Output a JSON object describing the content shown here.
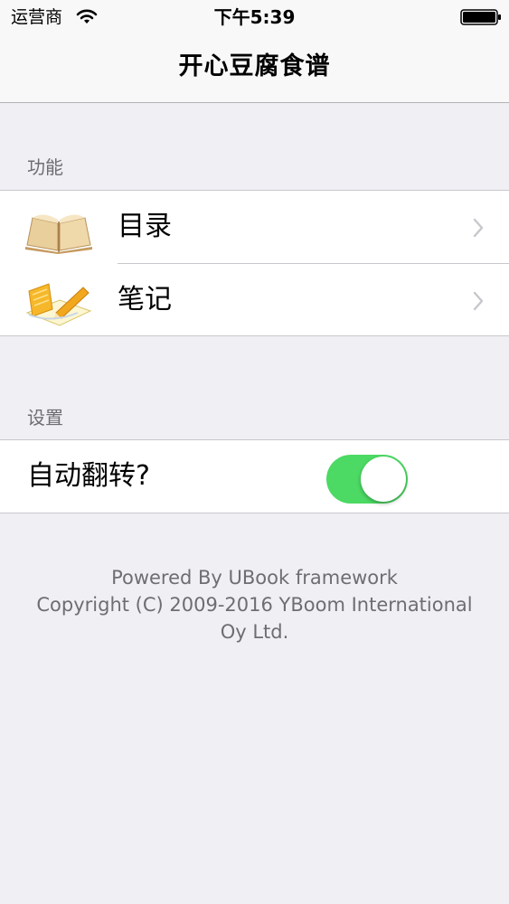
{
  "status_bar": {
    "carrier": "运营商",
    "time": "下午5:39",
    "wifi_icon": "wifi-icon",
    "battery_icon": "battery-icon"
  },
  "nav": {
    "title": "开心豆腐食谱"
  },
  "sections": {
    "features": {
      "header": "功能",
      "items": [
        {
          "label": "目录",
          "icon": "open-book-icon"
        },
        {
          "label": "笔记",
          "icon": "notebook-pencil-icon"
        }
      ]
    },
    "settings": {
      "header": "设置",
      "auto_rotate": {
        "label": "自动翻转?",
        "enabled": true
      }
    }
  },
  "footer": {
    "line1": "Powered By UBook framework",
    "line2": "Copyright (C) 2009-2016 YBoom International",
    "line3": "Oy Ltd."
  },
  "colors": {
    "background": "#efeff4",
    "toggle_on": "#4cd964",
    "section_text": "#6d6d72",
    "separator": "#c8c7cc"
  }
}
